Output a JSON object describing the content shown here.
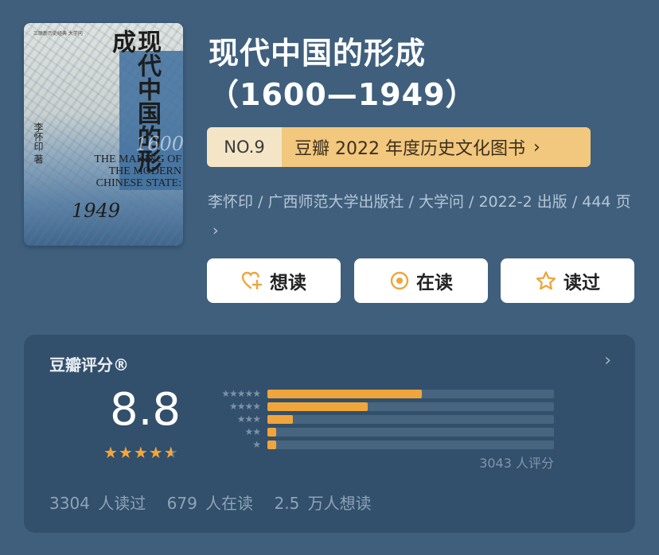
{
  "cover": {
    "title": "现代中国的形成",
    "years": "1600",
    "english": "THE MAKING OF THE MODERN CHINESE STATE:",
    "end_year": "1949",
    "author": "李怀印 著",
    "series": "三联新历史经典 大学问"
  },
  "book": {
    "title_line1": "现代中国的形成",
    "title_line2": "（1600—1949）",
    "meta": "李怀印 / 广西师范大学出版社 / 大学问 / 2022-2 出版 / 444 页",
    "meta_chevron": "›"
  },
  "rank": {
    "no": "NO.9",
    "label": "豆瓣 2022 年度历史文化图书",
    "chevron": "›"
  },
  "actions": {
    "want": "想读",
    "reading": "在读",
    "read": "读过"
  },
  "rating": {
    "header": "豆瓣评分®",
    "chevron": "›",
    "score": "8.8",
    "stars_value": 4.5,
    "star_full": "★★★★",
    "star_half": "★",
    "distribution": [
      {
        "stars": "★★★★★",
        "fraction": 0.54
      },
      {
        "stars": "★★★★",
        "fraction": 0.35
      },
      {
        "stars": "★★★",
        "fraction": 0.09
      },
      {
        "stars": "★★",
        "fraction": 0.03
      },
      {
        "stars": "★",
        "fraction": 0.03
      }
    ],
    "count": "3043 人评分",
    "stats": {
      "read": "3304 人读过",
      "reading": "679 人在读",
      "want": "2.5 万人想读"
    }
  },
  "colors": {
    "background": "#3f5f7d",
    "card": "#324f6b",
    "accent": "#f0a53b",
    "rank_gold": "#f2c77e"
  }
}
